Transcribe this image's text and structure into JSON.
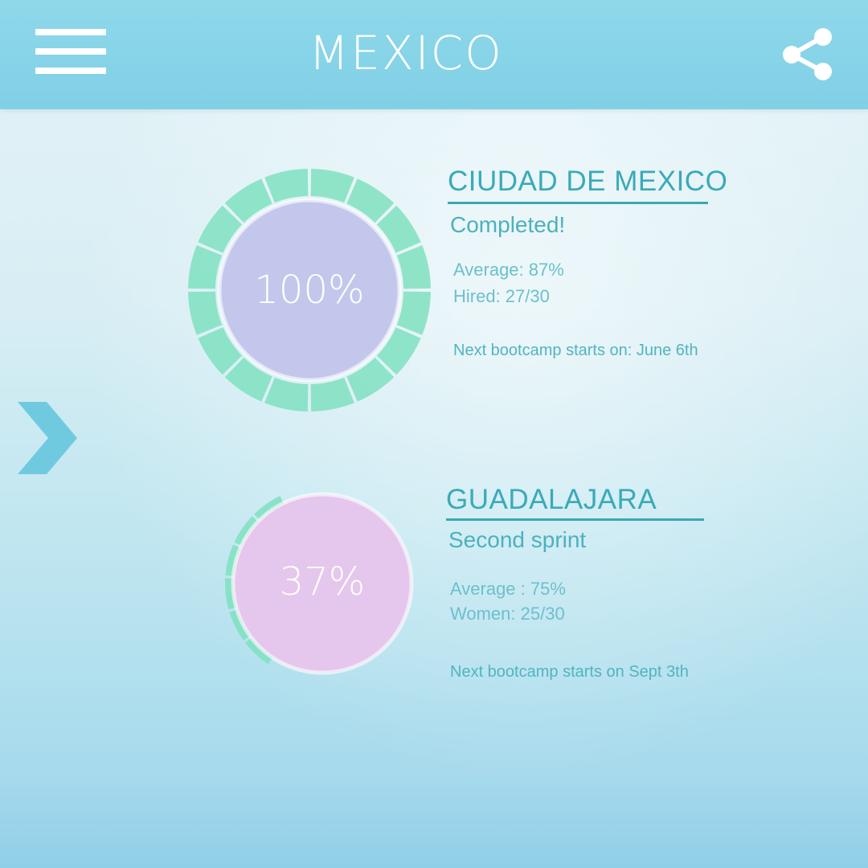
{
  "header": {
    "title": "MEXICO",
    "menu_icon": "hamburger-menu-icon",
    "share_icon": "share-icon"
  },
  "nav": {
    "next_icon": "chevron-right-icon"
  },
  "theme": {
    "header_bg": "#80d0e6",
    "ring_green": "#7fe0bf",
    "text_teal": "#3aaab8"
  },
  "cities": [
    {
      "name": "CIUDAD DE MEXICO",
      "status": "Completed!",
      "progress_label": "100%",
      "progress": 1.0,
      "circle_color": "#c3c7ec",
      "stats": [
        "Average: 87%",
        "Hired: 27/30"
      ],
      "next_bootcamp": "Next bootcamp starts on: June 6th"
    },
    {
      "name": "GUADALAJARA",
      "status": "Second sprint",
      "progress_label": "37%",
      "progress": 0.37,
      "circle_color": "#e5c6ec",
      "stats": [
        "Average : 75%",
        "Women: 25/30"
      ],
      "next_bootcamp": "Next bootcamp starts on Sept 3th"
    }
  ]
}
